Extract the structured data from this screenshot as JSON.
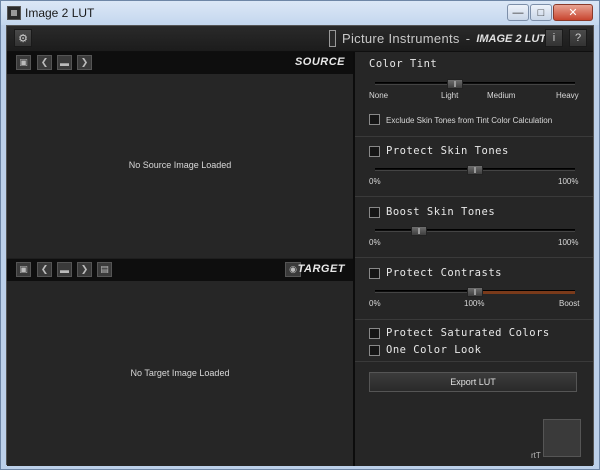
{
  "window": {
    "title": "Image 2 LUT",
    "min": "—",
    "max": "□",
    "close": "✕"
  },
  "topbar": {
    "brand": "Picture Instruments",
    "separator": "-",
    "product": "IMAGE 2 LUT",
    "info": "i",
    "help": "?"
  },
  "source": {
    "label": "SOURCE",
    "empty_message": "No Source Image Loaded"
  },
  "target": {
    "label": "TARGET",
    "empty_message": "No Target Image Loaded"
  },
  "color_tint": {
    "title": "Color Tint",
    "value_position": 0.4,
    "ticks": [
      "None",
      "Light",
      "Medium",
      "Heavy"
    ],
    "exclude_skin": {
      "label": "Exclude Skin Tones from Tint Color Calculation",
      "checked": false
    }
  },
  "protect_skin": {
    "label": "Protect Skin Tones",
    "checked": false,
    "value": 0.5,
    "min_label": "0%",
    "max_label": "100%"
  },
  "boost_skin": {
    "label": "Boost Skin Tones",
    "checked": false,
    "value": 0.22,
    "min_label": "0%",
    "max_label": "100%"
  },
  "protect_contrasts": {
    "label": "Protect Contrasts",
    "checked": false,
    "value": 0.5,
    "min_label": "0%",
    "mid_label": "100%",
    "max_label": "Boost"
  },
  "protect_saturated": {
    "label": "Protect Saturated Colors",
    "checked": false
  },
  "one_color": {
    "label": "One Color Look",
    "checked": false
  },
  "export": {
    "label": "Export LUT"
  },
  "corner": {
    "text": "rtT"
  },
  "colors": {
    "panel": "#262626",
    "header": "#0e0e0e",
    "boost_fill": "#7a3a1a"
  }
}
